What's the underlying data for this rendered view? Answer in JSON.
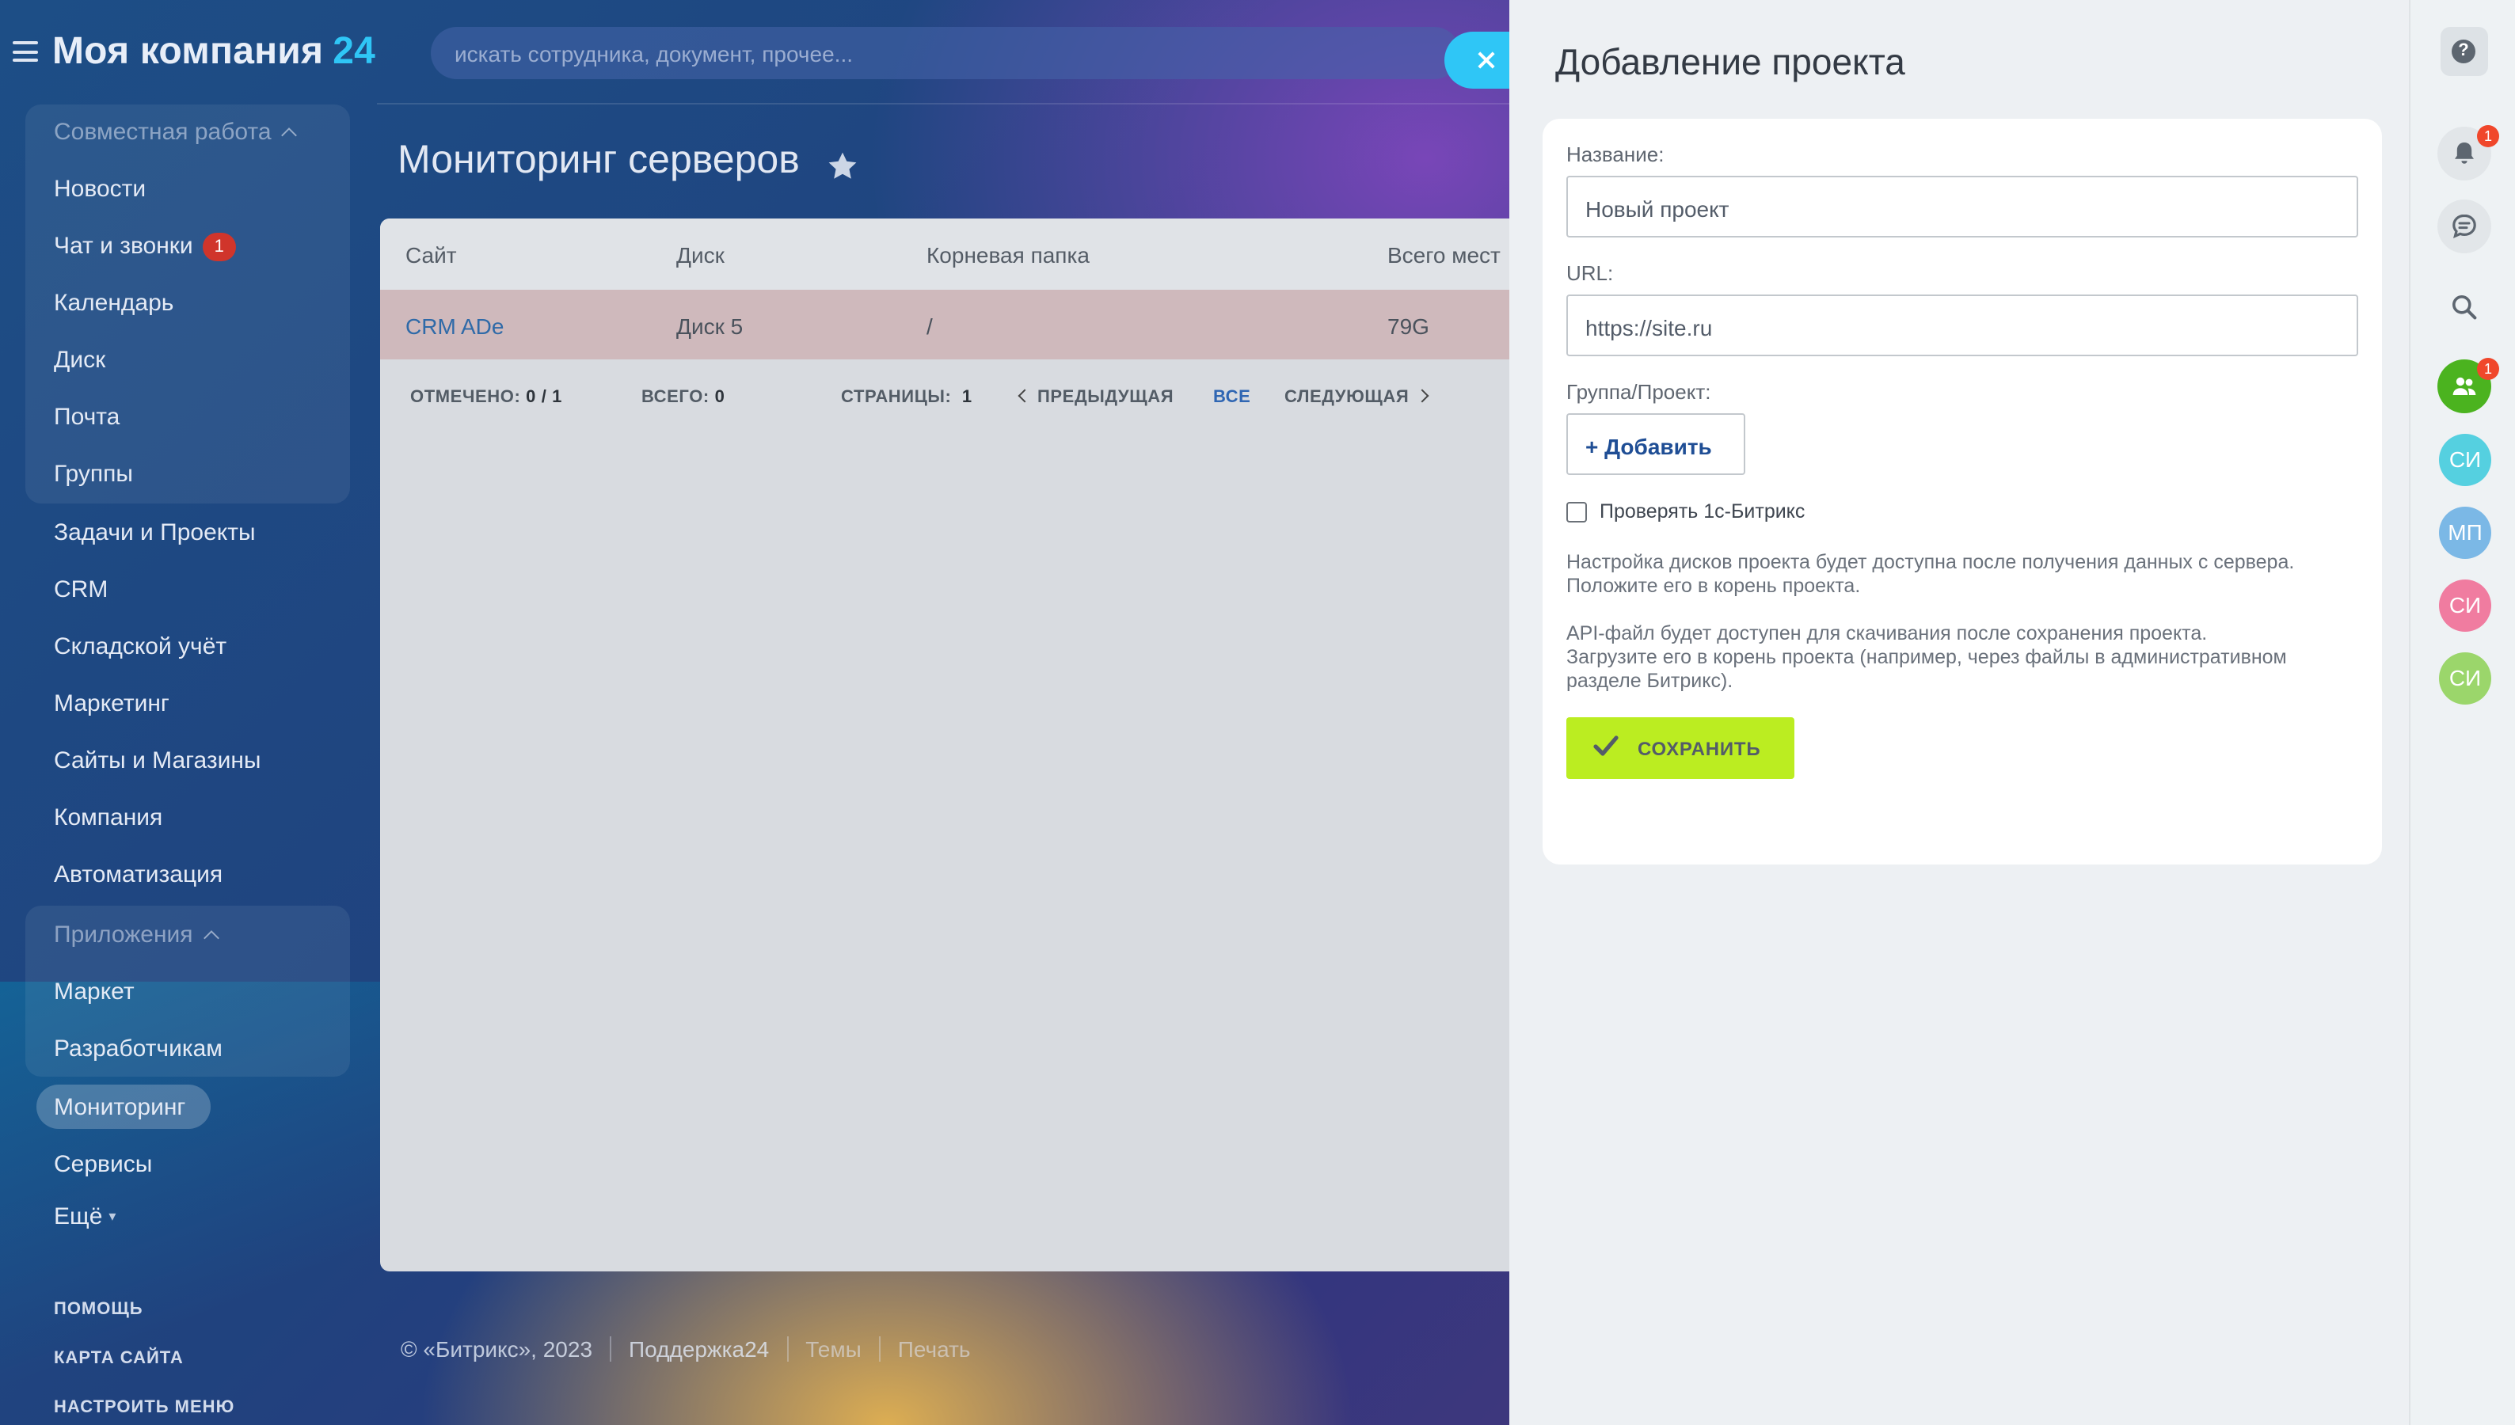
{
  "portal": {
    "logo_text": "Моя компания",
    "logo_num": "24",
    "search_placeholder": "искать сотрудника, документ, прочее..."
  },
  "menu": {
    "group1_title": "Совместная работа",
    "news": "Новости",
    "chat": "Чат и звонки",
    "chat_badge": "1",
    "calendar": "Календарь",
    "disk": "Диск",
    "mail": "Почта",
    "groups": "Группы",
    "tasks": "Задачи и Проекты",
    "crm": "CRM",
    "warehouse": "Складской учёт",
    "marketing": "Маркетинг",
    "sites": "Сайты и Магазины",
    "company": "Компания",
    "automation": "Автоматизация",
    "group2_title": "Приложения",
    "market": "Маркет",
    "developers": "Разработчикам",
    "monitoring": "Мониторинг",
    "services": "Сервисы",
    "more": "Ещё",
    "help": "ПОМОЩЬ",
    "sitemap": "КАРТА САЙТА",
    "configure": "НАСТРОИТЬ МЕНЮ"
  },
  "page": {
    "title": "Мониторинг серверов"
  },
  "grid": {
    "columns": [
      "Сайт",
      "Диск",
      "Корневая папка",
      "Всего мест"
    ],
    "rows": [
      {
        "site": "CRM ADe",
        "disk": "Диск 5",
        "root": "/",
        "total": "79G"
      }
    ],
    "footer": {
      "selected_label": "ОТМЕЧЕНО:",
      "selected_value": "0 / 1",
      "total_label": "ВСЕГО:",
      "total_value": "0",
      "pages_label": "СТРАНИЦЫ:",
      "pages_value": "1",
      "prev": "ПРЕДЫДУЩАЯ",
      "all": "ВСЕ",
      "next": "СЛЕДУЮЩАЯ"
    }
  },
  "footer": {
    "copyright": "© «Битрикс», 2023",
    "support": "Поддержка24",
    "themes": "Темы",
    "print": "Печать"
  },
  "slider": {
    "title": "Добавление проекта",
    "name_label": "Название:",
    "name_value": "Новый проект",
    "url_label": "URL:",
    "url_value": "https://site.ru",
    "group_label": "Группа/Проект:",
    "add_button": "+ Добавить",
    "check_label": "Проверять 1с-Битрикс",
    "check_checked": false,
    "note1_line1": "Настройка дисков проекта будет доступна после получения данных с сервера.",
    "note1_line2": "Положите его в корень проекта.",
    "note2_line1": "API-файл будет доступен для скачивания после сохранения проекта.",
    "note2_line2": "Загрузите его в корень проекта (например, через файлы в административном",
    "note2_line3": "разделе Битрикс).",
    "save_button": "СОХРАНИТЬ"
  },
  "rail": {
    "help_icon": "?",
    "notifications_badge": "1",
    "team_badge": "1",
    "avatars": [
      {
        "initials": "СИ",
        "color": "#55d0e0"
      },
      {
        "initials": "МП",
        "color": "#7bb8e6"
      },
      {
        "initials": "СИ",
        "color": "#f07ca0"
      },
      {
        "initials": "СИ",
        "color": "#9bd66b"
      }
    ]
  },
  "colors": {
    "accent": "#2fc6f6",
    "save_green": "#bbed21",
    "link_blue": "#2f6aa8",
    "badge_red": "#d0352b"
  }
}
